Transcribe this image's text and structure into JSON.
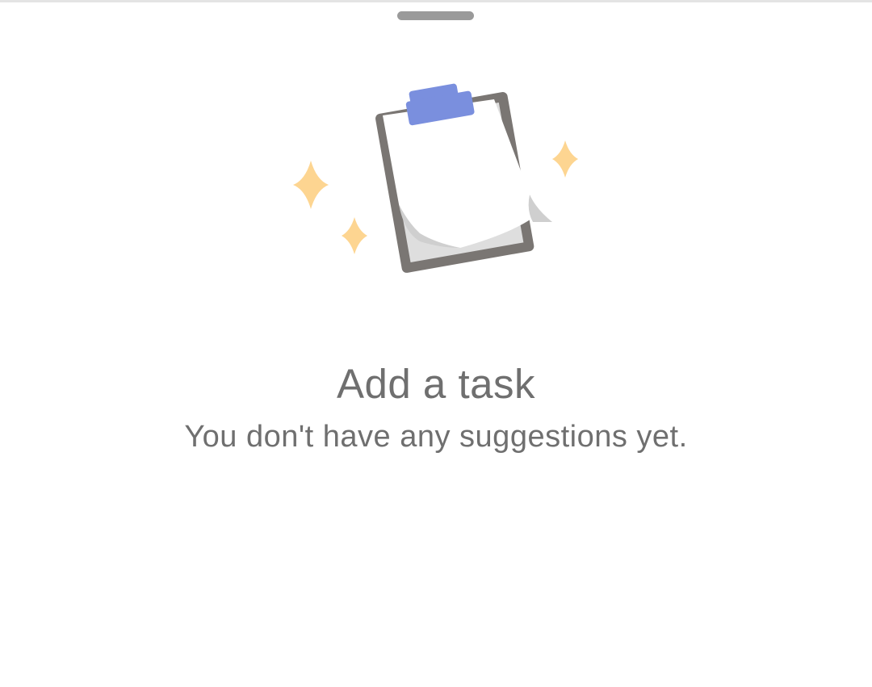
{
  "sheet": {
    "handle_icon": "drag-handle",
    "illustration_icon": "clipboard-with-sparkles-icon"
  },
  "empty_state": {
    "title": "Add a task",
    "subtitle": "You don't have any suggestions yet."
  },
  "colors": {
    "clipboard_frame": "#7a7673",
    "clip": "#7a8fde",
    "sparkle": "#fdd591",
    "text": "#6f6f6f",
    "handle": "#9a9a9a"
  }
}
